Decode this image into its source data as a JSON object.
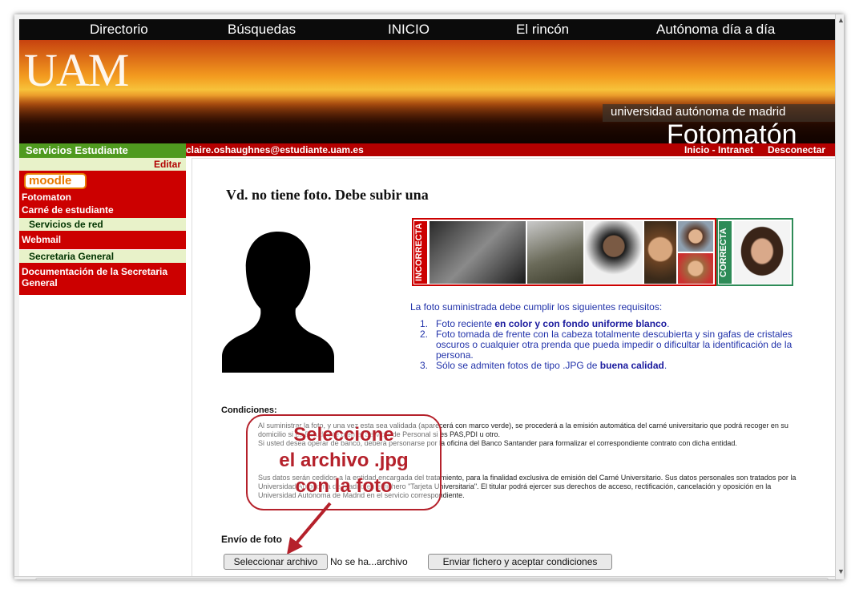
{
  "topnav": {
    "items": [
      "Directorio",
      "Búsquedas",
      "INICIO",
      "El rincón",
      "Autónoma día a día"
    ]
  },
  "banner": {
    "logo": "UAM",
    "university": "universidad autónoma de madrid",
    "app_title": "Fotomatón"
  },
  "sidebar": {
    "header": "Servicios Estudiante",
    "edit": "Editar",
    "moodle": "moodle",
    "items": [
      "Fotomaton",
      "Carné de estudiante",
      "Servicios de red",
      "Webmail",
      "Secretaria General",
      "Documentación de la Secretaria General"
    ]
  },
  "userbar": {
    "email": "claire.oshaughnes@estudiante.uam.es",
    "inicio": "Inicio - Intranet",
    "logout": "Desconectar"
  },
  "main": {
    "heading": "Vd. no tiene foto. Debe subir una",
    "label_incorrect": "INCORRECTA",
    "label_correct": "CORRECTA",
    "requirements_intro": "La foto suministrada debe cumplir los siguientes requisitos:",
    "requirements": [
      {
        "num": "1.",
        "text": "Foto reciente ",
        "bold": "en color y con fondo uniforme blanco",
        "tail": "."
      },
      {
        "num": "2.",
        "text": "Foto tomada de frente con la cabeza totalmente descubierta y sin gafas de cristales oscuros o cualquier otra prenda que pueda impedir o dificultar la identificación de la persona.",
        "bold": "",
        "tail": ""
      },
      {
        "num": "3.",
        "text": "Sólo se admiten fotos de tipo .JPG de ",
        "bold": "buena calidad",
        "tail": "."
      }
    ],
    "conditions_head": "Condiciones:",
    "conditions": [
      "Al suministrar la foto, y una vez esta sea validada (aparecerá con marco verde), se procederá a la emisión automática del carné universitario que podrá recoger en su domicilio si es Estudiante o en el Servicio de Personal si es PAS,PDI u otro.",
      "Si usted desea operar de banco, deberá personarse por la oficina del Banco Santander para formalizar el correspondiente contrato con dicha entidad.",
      "Sus datos serán cedidos a la entidad encargada del tratamiento, para la finalidad exclusiva de emisión del Carné Universitario. Sus datos personales son tratados por la Universidad Autónoma de Madrid en el fichero \"Tarjeta Universitaria\". El titular podrá ejercer sus derechos de acceso, rectificación, cancelación y oposición en la Universidad Autónoma de Madrid en el servicio correspondiente."
    ],
    "upload_head": "Envío de foto",
    "select_button": "Seleccionar archivo",
    "no_file": "No se ha...archivo",
    "submit_button": "Enviar fichero y aceptar condiciones"
  },
  "callout": {
    "lines": [
      "Seleccione",
      "el archivo .jpg",
      "con la foto"
    ]
  },
  "colors": {
    "red": "#cc0000",
    "green": "#4f9a1f",
    "text_blue": "#2233aa",
    "callout": "#b5212b"
  }
}
